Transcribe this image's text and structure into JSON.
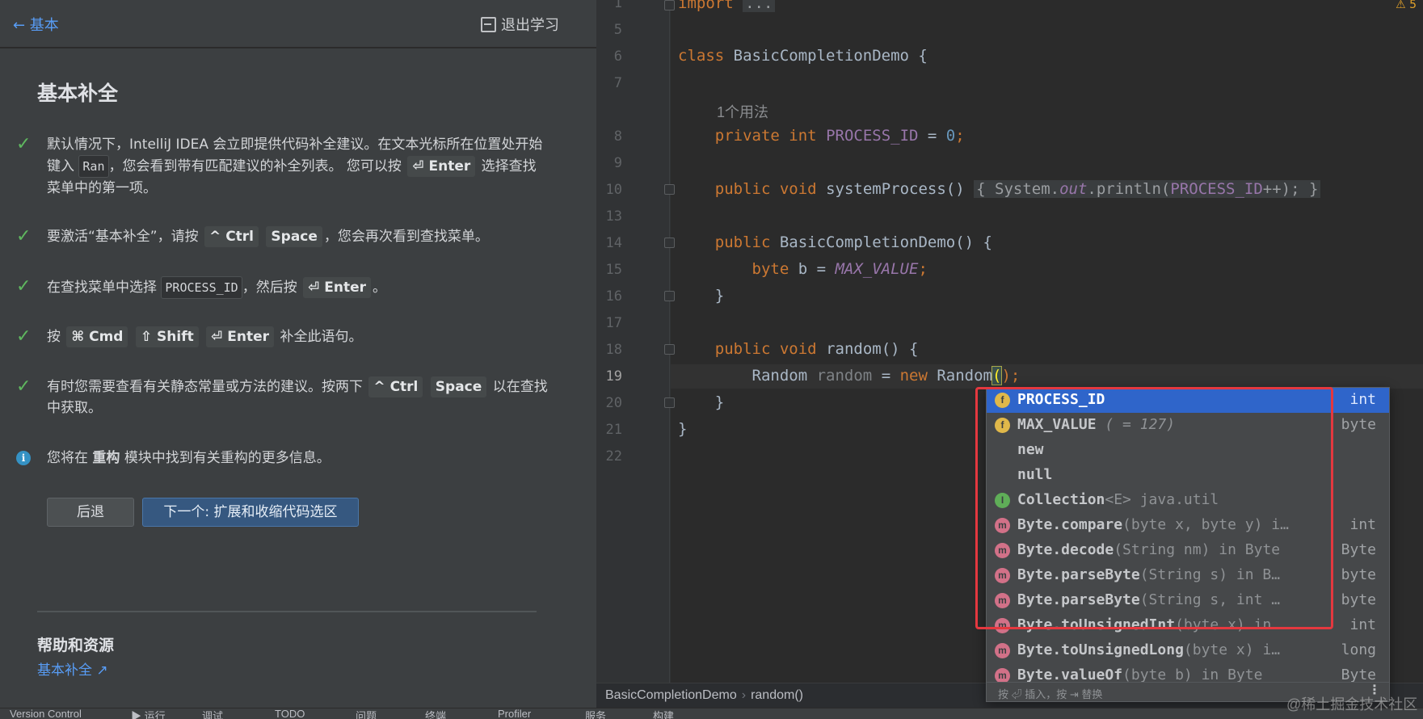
{
  "learn": {
    "back_label": "← 基本",
    "exit_label": "退出学习",
    "lesson_title": "基本补全",
    "steps": [
      {
        "a": "默认情况下，IntelliJ IDEA 会立即提供代码补全建议。在文本光标所在位置处开始键入",
        "code": "Ran",
        "b": "，您会看到带有匹配建议的补全列表。 您可以按",
        "key1": "⏎ Enter",
        "c": "选择查找菜单中的第一项。"
      },
      {
        "a": "要激活“基本补全”，请按",
        "key1": "^ Ctrl",
        "key2": "Space",
        "b": "，您会再次看到查找菜单。"
      },
      {
        "a": "在查找菜单中选择",
        "code": "PROCESS_ID",
        "b": "，然后按",
        "key1": "⏎ Enter",
        "c": "。"
      },
      {
        "a": "按",
        "key1": "⌘ Cmd",
        "key2": "⇧ Shift",
        "key3": "⏎ Enter",
        "b": "补全此语句。"
      },
      {
        "a": "有时您需要查看有关静态常量或方法的建议。按两下",
        "key1": "^ Ctrl",
        "key2": "Space",
        "b": "以在查找中获取。"
      }
    ],
    "info": {
      "a": "您将在",
      "bold": "重构",
      "b": "模块中找到有关重构的更多信息。"
    },
    "btn_back": "后退",
    "btn_next": "下一个: 扩展和收缩代码选区",
    "help_title": "帮助和资源",
    "help_link": "基本补全 ↗"
  },
  "editor": {
    "line_numbers": [
      "1",
      "5",
      "6",
      "7",
      "8",
      "9",
      "10",
      "13",
      "14",
      "15",
      "16",
      "17",
      "18",
      "19",
      "20",
      "21",
      "22"
    ],
    "warning": "⚠ 5",
    "usage_hint": "1个用法",
    "code": {
      "l1_import": "import",
      "l1_fold": "...",
      "l6_class": "class",
      "l6_name": "BasicCompletionDemo {",
      "l8_private": "private",
      "l8_int": "int",
      "l8_field": "PROCESS_ID",
      "l8_eq": " = ",
      "l8_num": "0",
      "l8_semi": ";",
      "l10_public": "public",
      "l10_void": "void",
      "l10_name": "systemProcess()",
      "l10_body_a": " System.",
      "l10_out": "out",
      "l10_body_b": ".println(",
      "l10_field": "PROCESS_ID",
      "l10_body_c": "++);",
      "l14_public": "public",
      "l14_name": "BasicCompletionDemo() {",
      "l15_byte": "byte",
      "l15_b": " b = ",
      "l15_max": "MAX_VALUE",
      "l15_semi": ";",
      "l16": "}",
      "l18_public": "public",
      "l18_void": "void",
      "l18_name": "random() {",
      "l19_type": "Random",
      "l19_var": "random",
      "l19_eq": " = ",
      "l19_new": "new",
      "l19_cls": " Random",
      "l19_paren": "(",
      "l19_close": ");",
      "l20": "}",
      "l21": "}"
    },
    "breadcrumb": [
      "BasicCompletionDemo",
      "random()"
    ]
  },
  "completion": {
    "items": [
      {
        "icon": "f",
        "name": "PROCESS_ID",
        "tail": "",
        "type": "int",
        "selected": true
      },
      {
        "icon": "f",
        "name": "MAX_VALUE",
        "tail": " ( = 127)",
        "type": "byte",
        "selected": false
      },
      {
        "icon": "",
        "name": "new",
        "tail": "",
        "type": "",
        "selected": false
      },
      {
        "icon": "",
        "name": "null",
        "tail": "",
        "type": "",
        "selected": false
      },
      {
        "icon": "i",
        "name": "Collection",
        "tail": "<E> java.util",
        "type": "",
        "selected": false
      },
      {
        "icon": "m",
        "name": "Byte.compare",
        "tail": "(byte x, byte y) i…",
        "type": "int",
        "selected": false
      },
      {
        "icon": "m",
        "name": "Byte.decode",
        "tail": "(String nm) in Byte",
        "type": "Byte",
        "selected": false
      },
      {
        "icon": "m",
        "name": "Byte.parseByte",
        "tail": "(String s) in B…",
        "type": "byte",
        "selected": false
      },
      {
        "icon": "m",
        "name": "Byte.parseByte",
        "tail": "(String s, int …",
        "type": "byte",
        "selected": false
      },
      {
        "icon": "m",
        "name": "Byte.toUnsignedInt",
        "tail": "(byte x) in …",
        "type": "int",
        "selected": false
      },
      {
        "icon": "m",
        "name": "Byte.toUnsignedLong",
        "tail": "(byte x) i…",
        "type": "long",
        "selected": false
      },
      {
        "icon": "m",
        "name": "Byte.valueOf",
        "tail": "(byte b) in Byte",
        "type": "Byte",
        "selected": false
      }
    ],
    "footer": "按 ⏎ 插入，按 ⇥ 替换"
  },
  "bottombar": [
    "Version Control",
    "▶ 运行",
    "调试",
    "TODO",
    "问题",
    "终端",
    "Profiler",
    "服务",
    "构建"
  ],
  "watermark": "@稀土掘金技术社区"
}
